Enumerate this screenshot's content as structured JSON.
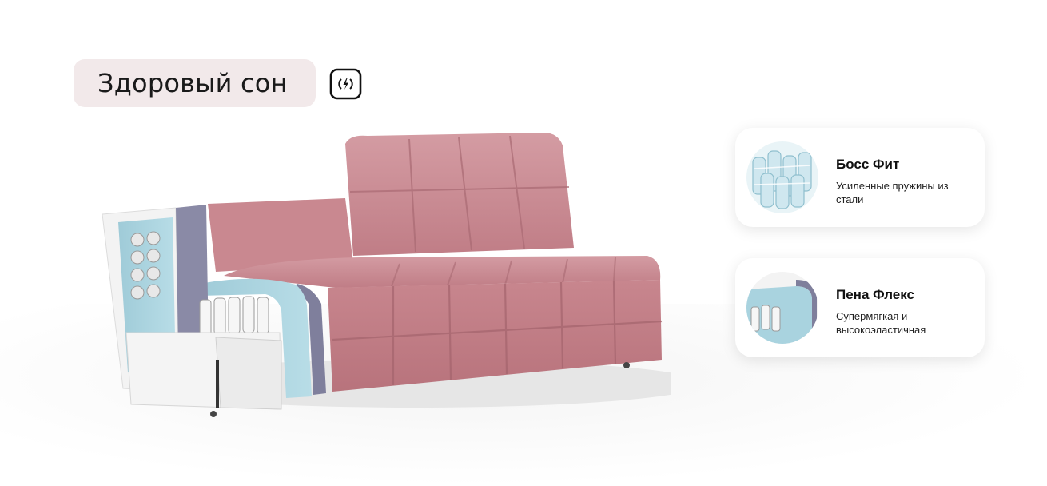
{
  "header": {
    "title": "Здоровый сон",
    "badge_icon": "fast-charge-icon"
  },
  "features": [
    {
      "title": "Босс Фит",
      "description": "Усиленные пружины из стали",
      "icon": "pocket-springs-icon"
    },
    {
      "title": "Пена Флекс",
      "description": "Супермягкая и высокоэластичная",
      "icon": "foam-layer-icon"
    }
  ],
  "colors": {
    "title_pill": "#f2e9ea",
    "upholstery": "#c8868e",
    "foam": "#a9d3df"
  }
}
